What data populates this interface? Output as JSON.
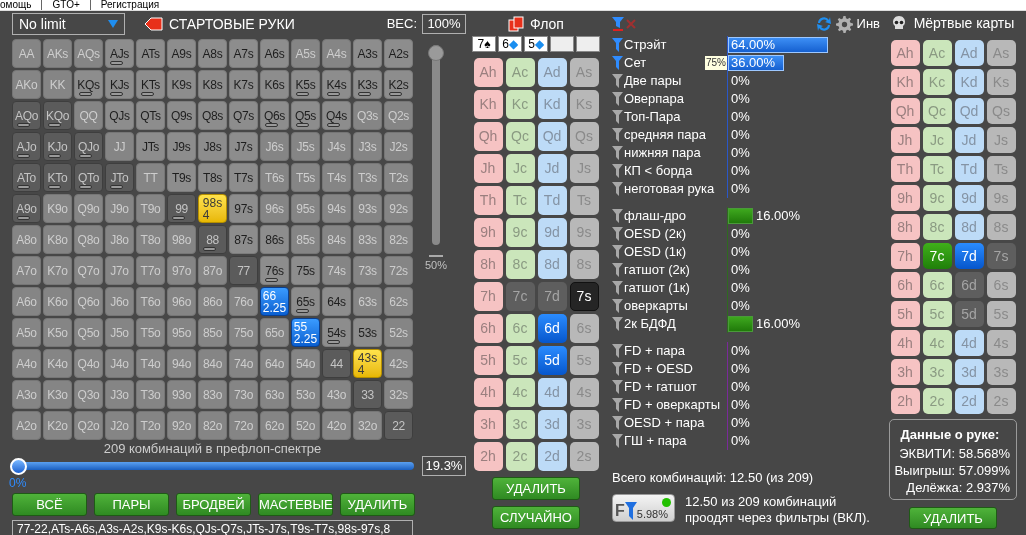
{
  "menu": [
    {
      "label": "омощь"
    },
    {
      "label": "GTO+"
    },
    {
      "label": "Регистрация"
    }
  ],
  "range_panel": {
    "game": "No limit",
    "title": "СТАРТОВЫЕ РУКИ",
    "weight_label": "ВЕС:",
    "weight": "100%",
    "weight_slider": {
      "level": 1,
      "tick": "50%"
    },
    "grid": [
      [
        {
          "label": "AA",
          "kind": "out",
          "marker": false
        },
        {
          "label": "AKs",
          "kind": "out",
          "marker": false
        },
        {
          "label": "AQs",
          "kind": "out",
          "marker": false
        },
        {
          "label": "AJs",
          "kind": "in",
          "marker": true
        },
        {
          "label": "ATs",
          "kind": "in",
          "marker": false
        },
        {
          "label": "A9s",
          "kind": "in",
          "marker": false
        },
        {
          "label": "A8s",
          "kind": "in",
          "marker": false
        },
        {
          "label": "A7s",
          "kind": "in",
          "marker": false
        },
        {
          "label": "A6s",
          "kind": "in",
          "marker": false
        },
        {
          "label": "A5s",
          "kind": "out",
          "marker": false
        },
        {
          "label": "A4s",
          "kind": "out",
          "marker": false
        },
        {
          "label": "A3s",
          "kind": "in",
          "marker": false
        },
        {
          "label": "A2s",
          "kind": "in",
          "marker": false
        }
      ],
      [
        {
          "label": "AKo",
          "kind": "out",
          "marker": false
        },
        {
          "label": "KK",
          "kind": "out",
          "marker": false
        },
        {
          "label": "KQs",
          "kind": "in",
          "marker": true
        },
        {
          "label": "KJs",
          "kind": "in",
          "marker": true
        },
        {
          "label": "KTs",
          "kind": "in",
          "marker": true
        },
        {
          "label": "K9s",
          "kind": "in",
          "marker": false
        },
        {
          "label": "K8s",
          "kind": "in",
          "marker": false
        },
        {
          "label": "K7s",
          "kind": "in",
          "marker": false
        },
        {
          "label": "K6s",
          "kind": "in",
          "marker": false
        },
        {
          "label": "K5s",
          "kind": "in",
          "marker": true
        },
        {
          "label": "K4s",
          "kind": "in",
          "marker": true
        },
        {
          "label": "K3s",
          "kind": "in",
          "marker": true
        },
        {
          "label": "K2s",
          "kind": "in",
          "marker": true
        }
      ],
      [
        {
          "label": "AQo",
          "kind": "dark",
          "marker": true
        },
        {
          "label": "KQo",
          "kind": "dark",
          "marker": true
        },
        {
          "label": "QQ",
          "kind": "out",
          "marker": false
        },
        {
          "label": "QJs",
          "kind": "in",
          "marker": false
        },
        {
          "label": "QTs",
          "kind": "in",
          "marker": false
        },
        {
          "label": "Q9s",
          "kind": "in",
          "marker": false
        },
        {
          "label": "Q8s",
          "kind": "in",
          "marker": false
        },
        {
          "label": "Q7s",
          "kind": "in",
          "marker": false
        },
        {
          "label": "Q6s",
          "kind": "in",
          "marker": true
        },
        {
          "label": "Q5s",
          "kind": "in",
          "marker": true
        },
        {
          "label": "Q4s",
          "kind": "in",
          "marker": true
        },
        {
          "label": "Q3s",
          "kind": "out",
          "marker": false
        },
        {
          "label": "Q2s",
          "kind": "out",
          "marker": false
        }
      ],
      [
        {
          "label": "AJo",
          "kind": "dark",
          "marker": true
        },
        {
          "label": "KJo",
          "kind": "dark",
          "marker": true
        },
        {
          "label": "QJo",
          "kind": "dark",
          "marker": true
        },
        {
          "label": "JJ",
          "kind": "out",
          "marker": false
        },
        {
          "label": "JTs",
          "kind": "in",
          "marker": false
        },
        {
          "label": "J9s",
          "kind": "in",
          "marker": false
        },
        {
          "label": "J8s",
          "kind": "in",
          "marker": false
        },
        {
          "label": "J7s",
          "kind": "in",
          "marker": false
        },
        {
          "label": "J6s",
          "kind": "out",
          "marker": false
        },
        {
          "label": "J5s",
          "kind": "out",
          "marker": false
        },
        {
          "label": "J4s",
          "kind": "out",
          "marker": false
        },
        {
          "label": "J3s",
          "kind": "out",
          "marker": false
        },
        {
          "label": "J2s",
          "kind": "out",
          "marker": false
        }
      ],
      [
        {
          "label": "ATo",
          "kind": "dark",
          "marker": true
        },
        {
          "label": "KTo",
          "kind": "dark",
          "marker": true
        },
        {
          "label": "QTo",
          "kind": "dark",
          "marker": true
        },
        {
          "label": "JTo",
          "kind": "dark",
          "marker": true
        },
        {
          "label": "TT",
          "kind": "out",
          "marker": false
        },
        {
          "label": "T9s",
          "kind": "in",
          "marker": false
        },
        {
          "label": "T8s",
          "kind": "in",
          "marker": false
        },
        {
          "label": "T7s",
          "kind": "in",
          "marker": false
        },
        {
          "label": "T6s",
          "kind": "out",
          "marker": false
        },
        {
          "label": "T5s",
          "kind": "out",
          "marker": false
        },
        {
          "label": "T4s",
          "kind": "out",
          "marker": false
        },
        {
          "label": "T3s",
          "kind": "out",
          "marker": false
        },
        {
          "label": "T2s",
          "kind": "out",
          "marker": false
        }
      ],
      [
        {
          "label": "A9o",
          "kind": "dark",
          "marker": true
        },
        {
          "label": "K9o",
          "kind": "out",
          "marker": false
        },
        {
          "label": "Q9o",
          "kind": "out",
          "marker": false
        },
        {
          "label": "J9o",
          "kind": "out",
          "marker": false
        },
        {
          "label": "T9o",
          "kind": "out",
          "marker": false
        },
        {
          "label": "99",
          "kind": "dark",
          "marker": true
        },
        {
          "label": "98s",
          "kind": "flop",
          "marker": false,
          "count": "4"
        },
        {
          "label": "97s",
          "kind": "in",
          "marker": false
        },
        {
          "label": "96s",
          "kind": "out",
          "marker": false
        },
        {
          "label": "95s",
          "kind": "out",
          "marker": false
        },
        {
          "label": "94s",
          "kind": "out",
          "marker": false
        },
        {
          "label": "93s",
          "kind": "out",
          "marker": false
        },
        {
          "label": "92s",
          "kind": "out",
          "marker": false
        }
      ],
      [
        {
          "label": "A8o",
          "kind": "out",
          "marker": false
        },
        {
          "label": "K8o",
          "kind": "out",
          "marker": false
        },
        {
          "label": "Q8o",
          "kind": "out",
          "marker": false
        },
        {
          "label": "J8o",
          "kind": "out",
          "marker": false
        },
        {
          "label": "T8o",
          "kind": "out",
          "marker": false
        },
        {
          "label": "98o",
          "kind": "out",
          "marker": false
        },
        {
          "label": "88",
          "kind": "dark",
          "marker": true
        },
        {
          "label": "87s",
          "kind": "in",
          "marker": false
        },
        {
          "label": "86s",
          "kind": "in",
          "marker": false
        },
        {
          "label": "85s",
          "kind": "out",
          "marker": false
        },
        {
          "label": "84s",
          "kind": "out",
          "marker": false
        },
        {
          "label": "83s",
          "kind": "out",
          "marker": false
        },
        {
          "label": "82s",
          "kind": "out",
          "marker": false
        }
      ],
      [
        {
          "label": "A7o",
          "kind": "out",
          "marker": false
        },
        {
          "label": "K7o",
          "kind": "out",
          "marker": false
        },
        {
          "label": "Q7o",
          "kind": "out",
          "marker": false
        },
        {
          "label": "J7o",
          "kind": "out",
          "marker": false
        },
        {
          "label": "T7o",
          "kind": "out",
          "marker": false
        },
        {
          "label": "97o",
          "kind": "out",
          "marker": false
        },
        {
          "label": "87o",
          "kind": "out",
          "marker": false
        },
        {
          "label": "77",
          "kind": "dark",
          "marker": false
        },
        {
          "label": "76s",
          "kind": "in",
          "marker": true
        },
        {
          "label": "75s",
          "kind": "in",
          "marker": false
        },
        {
          "label": "74s",
          "kind": "out",
          "marker": false
        },
        {
          "label": "73s",
          "kind": "out",
          "marker": false
        },
        {
          "label": "72s",
          "kind": "out",
          "marker": false
        }
      ],
      [
        {
          "label": "A6o",
          "kind": "out",
          "marker": false
        },
        {
          "label": "K6o",
          "kind": "out",
          "marker": false
        },
        {
          "label": "Q6o",
          "kind": "out",
          "marker": false
        },
        {
          "label": "J6o",
          "kind": "out",
          "marker": false
        },
        {
          "label": "T6o",
          "kind": "out",
          "marker": false
        },
        {
          "label": "96o",
          "kind": "out",
          "marker": false
        },
        {
          "label": "86o",
          "kind": "out",
          "marker": false
        },
        {
          "label": "76o",
          "kind": "out",
          "marker": false
        },
        {
          "label": "66",
          "kind": "set",
          "marker": false,
          "count": "2.25"
        },
        {
          "label": "65s",
          "kind": "in",
          "marker": true
        },
        {
          "label": "64s",
          "kind": "in",
          "marker": false
        },
        {
          "label": "63s",
          "kind": "out",
          "marker": false
        },
        {
          "label": "62s",
          "kind": "out",
          "marker": false
        }
      ],
      [
        {
          "label": "A5o",
          "kind": "out",
          "marker": false
        },
        {
          "label": "K5o",
          "kind": "out",
          "marker": false
        },
        {
          "label": "Q5o",
          "kind": "out",
          "marker": false
        },
        {
          "label": "J5o",
          "kind": "out",
          "marker": false
        },
        {
          "label": "T5o",
          "kind": "out",
          "marker": false
        },
        {
          "label": "95o",
          "kind": "out",
          "marker": false
        },
        {
          "label": "85o",
          "kind": "out",
          "marker": false
        },
        {
          "label": "75o",
          "kind": "out",
          "marker": false
        },
        {
          "label": "65o",
          "kind": "out",
          "marker": false
        },
        {
          "label": "55",
          "kind": "set",
          "marker": false,
          "count": "2.25"
        },
        {
          "label": "54s",
          "kind": "in",
          "marker": true
        },
        {
          "label": "53s",
          "kind": "in",
          "marker": false
        },
        {
          "label": "52s",
          "kind": "out",
          "marker": false
        }
      ],
      [
        {
          "label": "A4o",
          "kind": "out",
          "marker": false
        },
        {
          "label": "K4o",
          "kind": "out",
          "marker": false
        },
        {
          "label": "Q4o",
          "kind": "out",
          "marker": false
        },
        {
          "label": "J4o",
          "kind": "out",
          "marker": false
        },
        {
          "label": "T4o",
          "kind": "out",
          "marker": false
        },
        {
          "label": "94o",
          "kind": "out",
          "marker": false
        },
        {
          "label": "84o",
          "kind": "out",
          "marker": false
        },
        {
          "label": "74o",
          "kind": "out",
          "marker": false
        },
        {
          "label": "64o",
          "kind": "out",
          "marker": false
        },
        {
          "label": "54o",
          "kind": "out",
          "marker": false
        },
        {
          "label": "44",
          "kind": "dark",
          "marker": false
        },
        {
          "label": "43s",
          "kind": "flop",
          "marker": false,
          "count": "4"
        },
        {
          "label": "42s",
          "kind": "out",
          "marker": false
        }
      ],
      [
        {
          "label": "A3o",
          "kind": "out",
          "marker": false
        },
        {
          "label": "K3o",
          "kind": "out",
          "marker": false
        },
        {
          "label": "Q3o",
          "kind": "out",
          "marker": false
        },
        {
          "label": "J3o",
          "kind": "out",
          "marker": false
        },
        {
          "label": "T3o",
          "kind": "out",
          "marker": false
        },
        {
          "label": "93o",
          "kind": "out",
          "marker": false
        },
        {
          "label": "83o",
          "kind": "out",
          "marker": false
        },
        {
          "label": "73o",
          "kind": "out",
          "marker": false
        },
        {
          "label": "63o",
          "kind": "out",
          "marker": false
        },
        {
          "label": "53o",
          "kind": "out",
          "marker": false
        },
        {
          "label": "43o",
          "kind": "out",
          "marker": false
        },
        {
          "label": "33",
          "kind": "dark",
          "marker": false
        },
        {
          "label": "32s",
          "kind": "out",
          "marker": false
        }
      ],
      [
        {
          "label": "A2o",
          "kind": "out",
          "marker": false
        },
        {
          "label": "K2o",
          "kind": "out",
          "marker": false
        },
        {
          "label": "Q2o",
          "kind": "out",
          "marker": false
        },
        {
          "label": "J2o",
          "kind": "out",
          "marker": false
        },
        {
          "label": "T2o",
          "kind": "out",
          "marker": false
        },
        {
          "label": "92o",
          "kind": "out",
          "marker": false
        },
        {
          "label": "82o",
          "kind": "out",
          "marker": false
        },
        {
          "label": "72o",
          "kind": "out",
          "marker": false
        },
        {
          "label": "62o",
          "kind": "out",
          "marker": false
        },
        {
          "label": "52o",
          "kind": "out",
          "marker": false
        },
        {
          "label": "42o",
          "kind": "out",
          "marker": false
        },
        {
          "label": "32o",
          "kind": "out",
          "marker": false
        },
        {
          "label": "22",
          "kind": "dark",
          "marker": false
        }
      ]
    ],
    "combos_caption": "209 комбинаций в префлоп-спектре",
    "range_slider": {
      "level": 0,
      "reading": "0%",
      "value": "19.3%"
    },
    "buttons": [
      "ВСЁ",
      "ПАРЫ",
      "БРОДВЕЙ",
      "МАСТЕВЫЕ",
      "УДАЛИТЬ"
    ],
    "range_text": "77-22,ATs-A6s,A3s-A2s,K9s-K6s,QJs-Q7s,JTs-J7s,T9s-T7s,98s-97s,8"
  },
  "flop": {
    "title": "Флоп",
    "board": [
      {
        "kind": "card",
        "rank": "7",
        "symbol": "♠",
        "color": "#000000"
      },
      {
        "kind": "card",
        "rank": "6",
        "symbol": "◆",
        "color": "#1a8ef0"
      },
      {
        "kind": "card",
        "rank": "5",
        "symbol": "◆",
        "color": "#1a8ef0"
      },
      {
        "kind": "empty"
      },
      {
        "kind": "empty"
      }
    ],
    "columns": [
      {
        "kind": "hearts",
        "cards": [
          {
            "label": "Ah",
            "kind": "normal"
          },
          {
            "label": "Kh",
            "kind": "normal"
          },
          {
            "label": "Qh",
            "kind": "normal"
          },
          {
            "label": "Jh",
            "kind": "normal"
          },
          {
            "label": "Th",
            "kind": "normal"
          },
          {
            "label": "9h",
            "kind": "normal"
          },
          {
            "label": "8h",
            "kind": "normal"
          },
          {
            "label": "7h",
            "kind": "normal"
          },
          {
            "label": "6h",
            "kind": "normal"
          },
          {
            "label": "5h",
            "kind": "normal"
          },
          {
            "label": "4h",
            "kind": "normal"
          },
          {
            "label": "3h",
            "kind": "normal"
          },
          {
            "label": "2h",
            "kind": "normal"
          }
        ]
      },
      {
        "kind": "clubs",
        "cards": [
          {
            "label": "Ac",
            "kind": "normal"
          },
          {
            "label": "Kc",
            "kind": "normal"
          },
          {
            "label": "Qc",
            "kind": "normal"
          },
          {
            "label": "Jc",
            "kind": "normal"
          },
          {
            "label": "Tc",
            "kind": "normal"
          },
          {
            "label": "9c",
            "kind": "normal"
          },
          {
            "label": "8c",
            "kind": "normal"
          },
          {
            "label": "7c",
            "kind": "dead"
          },
          {
            "label": "6c",
            "kind": "normal"
          },
          {
            "label": "5c",
            "kind": "normal"
          },
          {
            "label": "4c",
            "kind": "normal"
          },
          {
            "label": "3c",
            "kind": "normal"
          },
          {
            "label": "2c",
            "kind": "normal"
          }
        ]
      },
      {
        "kind": "diamonds",
        "cards": [
          {
            "label": "Ad",
            "kind": "normal"
          },
          {
            "label": "Kd",
            "kind": "normal"
          },
          {
            "label": "Qd",
            "kind": "normal"
          },
          {
            "label": "Jd",
            "kind": "normal"
          },
          {
            "label": "Td",
            "kind": "normal"
          },
          {
            "label": "9d",
            "kind": "normal"
          },
          {
            "label": "8d",
            "kind": "normal"
          },
          {
            "label": "7d",
            "kind": "dead"
          },
          {
            "label": "6d",
            "kind": "selected"
          },
          {
            "label": "5d",
            "kind": "selected"
          },
          {
            "label": "4d",
            "kind": "normal"
          },
          {
            "label": "3d",
            "kind": "normal"
          },
          {
            "label": "2d",
            "kind": "normal"
          }
        ]
      },
      {
        "kind": "spades",
        "cards": [
          {
            "label": "As",
            "kind": "normal"
          },
          {
            "label": "Ks",
            "kind": "normal"
          },
          {
            "label": "Qs",
            "kind": "normal"
          },
          {
            "label": "Js",
            "kind": "normal"
          },
          {
            "label": "Ts",
            "kind": "normal"
          },
          {
            "label": "9s",
            "kind": "normal"
          },
          {
            "label": "8s",
            "kind": "normal"
          },
          {
            "label": "7s",
            "kind": "board"
          },
          {
            "label": "6s",
            "kind": "normal"
          },
          {
            "label": "5s",
            "kind": "normal"
          },
          {
            "label": "4s",
            "kind": "normal"
          },
          {
            "label": "3s",
            "kind": "normal"
          },
          {
            "label": "2s",
            "kind": "normal"
          }
        ]
      }
    ],
    "buttons": [
      "УДАЛИТЬ",
      "СЛУЧАЙНО"
    ]
  },
  "stats": {
    "invert": "Инв",
    "groups": [
      {
        "kind": "made",
        "rows": [
          {
            "label": "Стрэйт",
            "active": true,
            "level": 0.64,
            "value": "64.00%"
          },
          {
            "label": "Сет",
            "active": true,
            "level": 0.36,
            "value": "36.00%",
            "tooltip": "75%"
          },
          {
            "label": "Две пары",
            "active": false,
            "value": "0%"
          },
          {
            "label": "Оверпара",
            "active": false,
            "value": "0%"
          },
          {
            "label": "Топ-Пара",
            "active": false,
            "value": "0%"
          },
          {
            "label": "средняя пара",
            "active": false,
            "value": "0%"
          },
          {
            "label": "нижняя пара",
            "active": false,
            "value": "0%"
          },
          {
            "label": "КП < борда",
            "active": false,
            "value": "0%"
          },
          {
            "label": "неготовая рука",
            "active": false,
            "value": "0%"
          }
        ]
      },
      {
        "kind": "draw",
        "rows": [
          {
            "label": "флаш-дро",
            "active": false,
            "level": 0.16,
            "value": "16.00%"
          },
          {
            "label": "OESD (2к)",
            "active": false,
            "value": "0%"
          },
          {
            "label": "OESD (1к)",
            "active": false,
            "value": "0%"
          },
          {
            "label": "гатшот (2к)",
            "active": false,
            "value": "0%"
          },
          {
            "label": "гатшот (1к)",
            "active": false,
            "value": "0%"
          },
          {
            "label": "оверкарты",
            "active": false,
            "value": "0%"
          },
          {
            "label": "2к БДФД",
            "active": false,
            "level": 0.16,
            "value": "16.00%"
          }
        ]
      },
      {
        "kind": "combo",
        "rows": [
          {
            "label": "FD + пара",
            "active": false,
            "value": "0%"
          },
          {
            "label": "FD + OESD",
            "active": false,
            "value": "0%"
          },
          {
            "label": "FD + гатшот",
            "active": false,
            "value": "0%"
          },
          {
            "label": "FD + оверкарты",
            "active": false,
            "value": "0%"
          },
          {
            "label": "OESD + пара",
            "active": false,
            "value": "0%"
          },
          {
            "label": "ГШ + пара",
            "active": false,
            "value": "0%"
          }
        ]
      }
    ],
    "total": "Всего комбинаций: 12.50 (из 209)",
    "filter_button": {
      "letter": "F",
      "value": "5.98%",
      "on": true
    },
    "summary": [
      "12.50 из 209 комбинаций",
      "проодят через фильтры (ВКЛ)."
    ]
  },
  "dead_cards": {
    "title": "Мёртвые карты",
    "columns": [
      {
        "kind": "hearts",
        "cards": [
          {
            "label": "Ah",
            "kind": "normal"
          },
          {
            "label": "Kh",
            "kind": "normal"
          },
          {
            "label": "Qh",
            "kind": "normal"
          },
          {
            "label": "Jh",
            "kind": "normal"
          },
          {
            "label": "Th",
            "kind": "normal"
          },
          {
            "label": "9h",
            "kind": "normal"
          },
          {
            "label": "8h",
            "kind": "normal"
          },
          {
            "label": "7h",
            "kind": "normal"
          },
          {
            "label": "6h",
            "kind": "normal"
          },
          {
            "label": "5h",
            "kind": "normal"
          },
          {
            "label": "4h",
            "kind": "normal"
          },
          {
            "label": "3h",
            "kind": "normal"
          },
          {
            "label": "2h",
            "kind": "normal"
          }
        ]
      },
      {
        "kind": "clubs",
        "cards": [
          {
            "label": "Ac",
            "kind": "normal"
          },
          {
            "label": "Kc",
            "kind": "normal"
          },
          {
            "label": "Qc",
            "kind": "normal"
          },
          {
            "label": "Jc",
            "kind": "normal"
          },
          {
            "label": "Tc",
            "kind": "normal"
          },
          {
            "label": "9c",
            "kind": "normal"
          },
          {
            "label": "8c",
            "kind": "normal"
          },
          {
            "label": "7c",
            "kind": "selected"
          },
          {
            "label": "6c",
            "kind": "normal"
          },
          {
            "label": "5c",
            "kind": "normal"
          },
          {
            "label": "4c",
            "kind": "normal"
          },
          {
            "label": "3c",
            "kind": "normal"
          },
          {
            "label": "2c",
            "kind": "normal"
          }
        ]
      },
      {
        "kind": "diamonds",
        "cards": [
          {
            "label": "Ad",
            "kind": "normal"
          },
          {
            "label": "Kd",
            "kind": "normal"
          },
          {
            "label": "Qd",
            "kind": "normal"
          },
          {
            "label": "Jd",
            "kind": "normal"
          },
          {
            "label": "Td",
            "kind": "normal"
          },
          {
            "label": "9d",
            "kind": "normal"
          },
          {
            "label": "8d",
            "kind": "normal"
          },
          {
            "label": "7d",
            "kind": "selected"
          },
          {
            "label": "6d",
            "kind": "dead"
          },
          {
            "label": "5d",
            "kind": "dead"
          },
          {
            "label": "4d",
            "kind": "normal"
          },
          {
            "label": "3d",
            "kind": "normal"
          },
          {
            "label": "2d",
            "kind": "normal"
          }
        ]
      },
      {
        "kind": "spades",
        "cards": [
          {
            "label": "As",
            "kind": "normal"
          },
          {
            "label": "Ks",
            "kind": "normal"
          },
          {
            "label": "Qs",
            "kind": "normal"
          },
          {
            "label": "Js",
            "kind": "normal"
          },
          {
            "label": "Ts",
            "kind": "normal"
          },
          {
            "label": "9s",
            "kind": "normal"
          },
          {
            "label": "8s",
            "kind": "normal"
          },
          {
            "label": "7s",
            "kind": "dead"
          },
          {
            "label": "6s",
            "kind": "normal"
          },
          {
            "label": "5s",
            "kind": "normal"
          },
          {
            "label": "4s",
            "kind": "normal"
          },
          {
            "label": "3s",
            "kind": "normal"
          },
          {
            "label": "2s",
            "kind": "normal"
          }
        ]
      }
    ],
    "hand_info": {
      "title": "Данные о руке:",
      "lines": [
        "ЭКВИТИ: 58.568%",
        "Выигрыш: 57.099%",
        "Делёжка: 2.937%"
      ]
    },
    "button": "УДАЛИТЬ"
  }
}
